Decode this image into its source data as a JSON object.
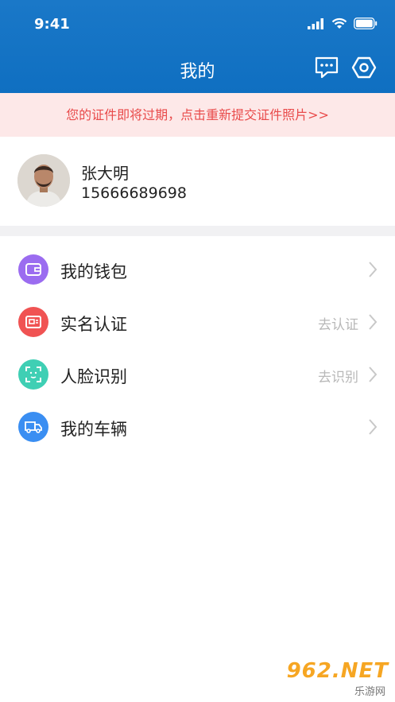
{
  "status_bar": {
    "time": "9:41"
  },
  "header": {
    "title": "我的"
  },
  "notice": {
    "text": "您的证件即将过期，点击重新提交证件照片>>"
  },
  "profile": {
    "name": "张大明",
    "phone": "15666689698"
  },
  "menu": {
    "items": [
      {
        "label": "我的钱包",
        "hint": "",
        "icon": "wallet-icon",
        "color": "#9b6cf0"
      },
      {
        "label": "实名认证",
        "hint": "去认证",
        "icon": "id-card-icon",
        "color": "#f05353"
      },
      {
        "label": "人脸识别",
        "hint": "去识别",
        "icon": "face-scan-icon",
        "color": "#3fcfb4"
      },
      {
        "label": "我的车辆",
        "hint": "",
        "icon": "truck-icon",
        "color": "#3a8ef2"
      }
    ]
  },
  "watermark": {
    "main": "962.NET",
    "sub": "乐游网"
  },
  "colors": {
    "header": "#1470c4",
    "notice_bg": "#fde8e8",
    "notice_text": "#e94b4b"
  }
}
